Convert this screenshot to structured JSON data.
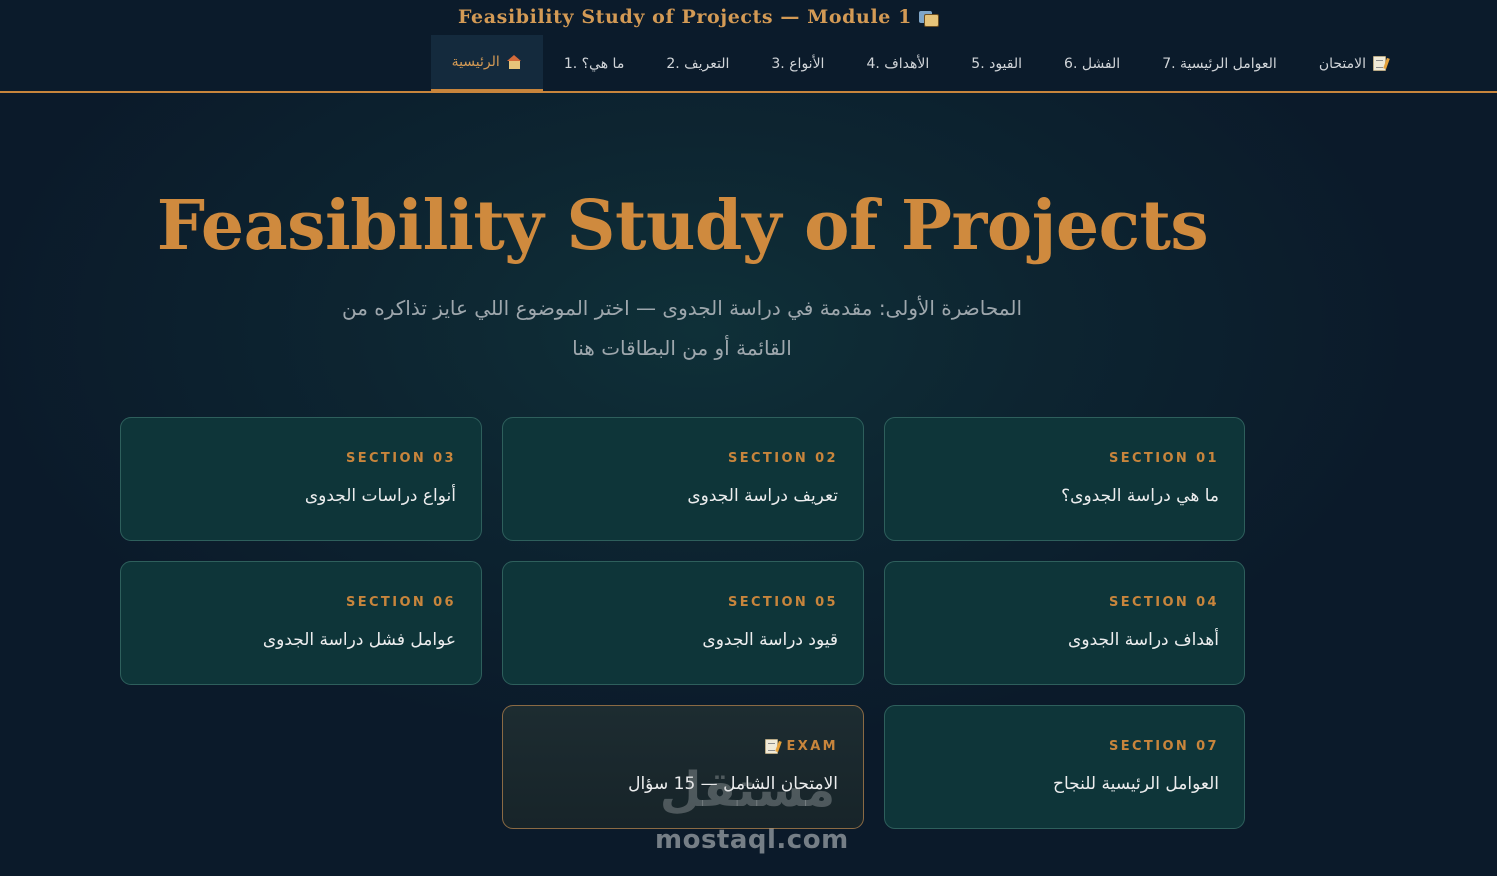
{
  "header": {
    "brand": "Feasibility Study of Projects — Module 1",
    "brand_icon": "books-icon"
  },
  "nav": {
    "items": [
      {
        "label": "الرئيسية",
        "icon": "house-icon",
        "active": true
      },
      {
        "label": "1. ما هي؟"
      },
      {
        "label": "2. التعريف"
      },
      {
        "label": "3. الأنواع"
      },
      {
        "label": "4. الأهداف"
      },
      {
        "label": "5. القيود"
      },
      {
        "label": "6. الفشل"
      },
      {
        "label": "7. العوامل الرئيسية"
      },
      {
        "label": "الامتحان",
        "icon": "memo-icon"
      }
    ]
  },
  "hero": {
    "title": "Feasibility Study of Projects",
    "subtitle": "المحاضرة الأولى: مقدمة في دراسة الجدوى — اختر الموضوع اللي عايز تذاكره من القائمة أو من البطاقات هنا"
  },
  "cards": [
    {
      "tag": "SECTION 01",
      "title": "ما هي دراسة الجدوى؟"
    },
    {
      "tag": "SECTION 02",
      "title": "تعريف دراسة الجدوى"
    },
    {
      "tag": "SECTION 03",
      "title": "أنواع دراسات الجدوى"
    },
    {
      "tag": "SECTION 04",
      "title": "أهداف دراسة الجدوى"
    },
    {
      "tag": "SECTION 05",
      "title": "قيود دراسة الجدوى"
    },
    {
      "tag": "SECTION 06",
      "title": "عوامل فشل دراسة الجدوى"
    },
    {
      "tag": "SECTION 07",
      "title": "العوامل الرئيسية للنجاح"
    },
    {
      "tag": "EXAM",
      "title": "الامتحان الشامل — 15 سؤال",
      "icon": "memo-icon"
    }
  ],
  "watermark": {
    "arabic": "مستقل",
    "url": "mostaql.com"
  },
  "colors": {
    "accent": "#c8853c",
    "background": "#0b1a2a",
    "card": "#0e3539"
  }
}
